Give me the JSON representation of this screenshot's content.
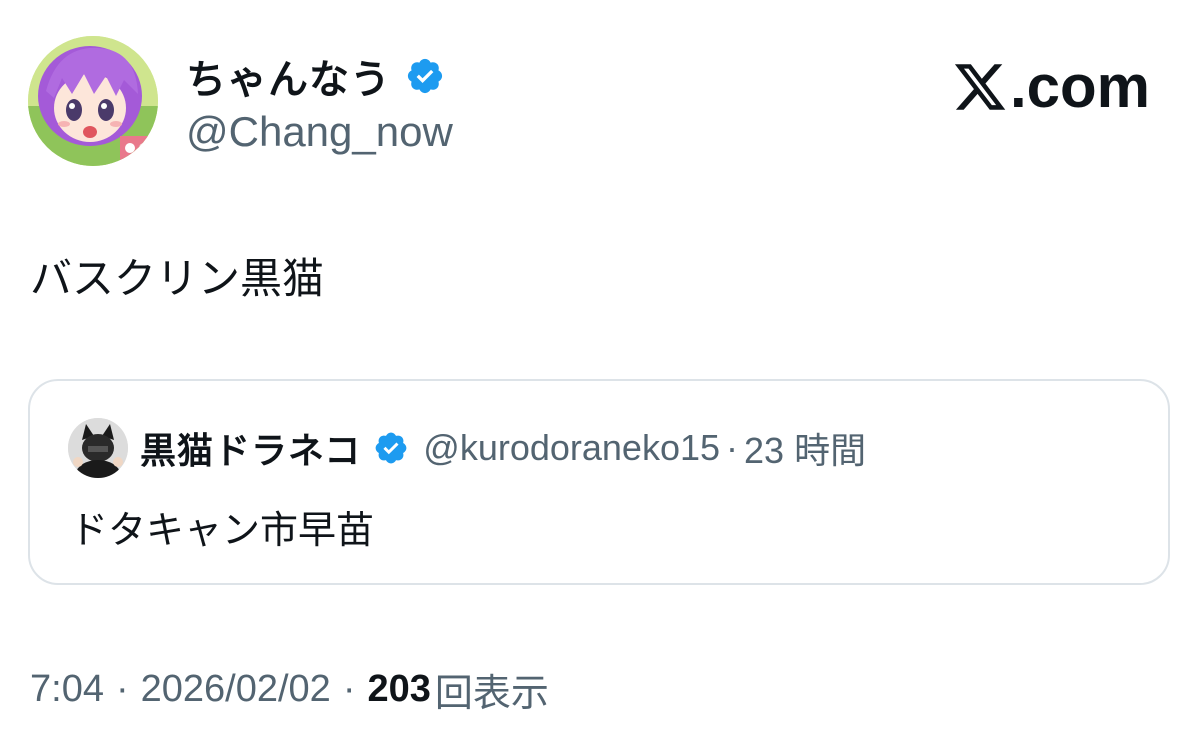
{
  "author": {
    "display_name": "ちゃんなう",
    "handle": "@Chang_now",
    "verified": true,
    "avatar": "anime-girl-purple-hair-avatar"
  },
  "brand": {
    "text": ".com",
    "logo": "x-logo-icon"
  },
  "tweet": {
    "text": "バスクリン黒猫"
  },
  "quoted_tweet": {
    "display_name": "黒猫ドラネコ",
    "handle": "@kurodoraneko15",
    "separator": "·",
    "time": "23",
    "time_unit": "時間",
    "verified": true,
    "avatar": "cat-ears-person-avatar",
    "text": "ドタキャン市早苗"
  },
  "meta": {
    "time": "7:04",
    "separator": "·",
    "date": "2026/02/02",
    "views_count": "203",
    "views_label": "回表示"
  },
  "colors": {
    "verified": "#1d9bf0",
    "text_primary": "#0f1419",
    "text_secondary": "#536471",
    "border": "#dde3e8"
  }
}
